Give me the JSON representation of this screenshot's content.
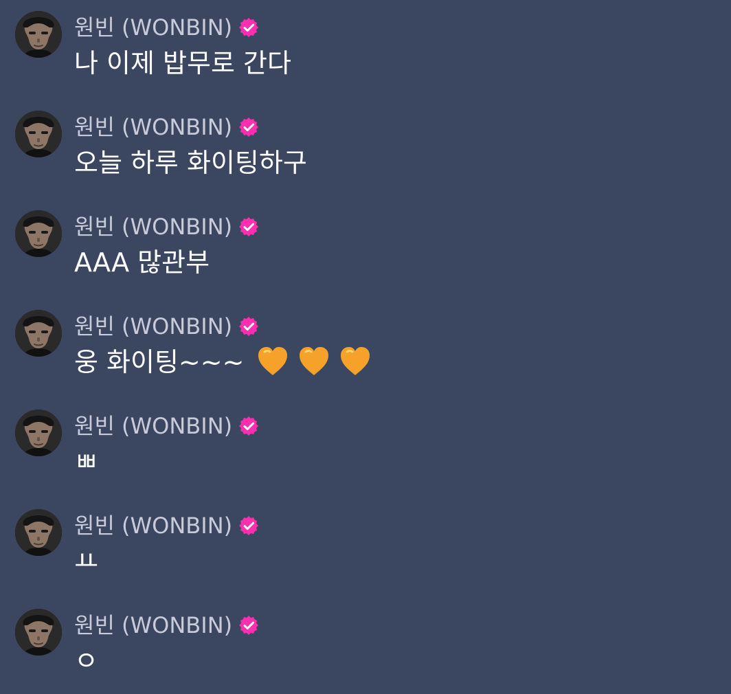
{
  "messages": [
    {
      "author": "원빈 (WONBIN)",
      "text": "나 이제 밥무로 간다",
      "hearts": []
    },
    {
      "author": "원빈 (WONBIN)",
      "text": "오늘 하루 화이팅하구",
      "hearts": []
    },
    {
      "author": "원빈 (WONBIN)",
      "text": "AAA 많관부",
      "hearts": []
    },
    {
      "author": "원빈 (WONBIN)",
      "text": "웅 화이팅~~~",
      "hearts": [
        "orange-heart-icon",
        "orange-heart-icon",
        "orange-heart-icon"
      ]
    },
    {
      "author": "원빈 (WONBIN)",
      "text": "ㅃ",
      "hearts": []
    },
    {
      "author": "원빈 (WONBIN)",
      "text": "ㅛ",
      "hearts": []
    },
    {
      "author": "원빈 (WONBIN)",
      "text": "ㅇ",
      "hearts": []
    }
  ],
  "theme": {
    "background": "#3b4661",
    "name_color": "#c9ccd8",
    "text_color": "#ffffff",
    "verified_color": "#ff2fb0",
    "heart_color": "#f6a12a"
  },
  "icons": {
    "verified": "verified-badge-icon",
    "heart": "orange-heart-icon"
  }
}
